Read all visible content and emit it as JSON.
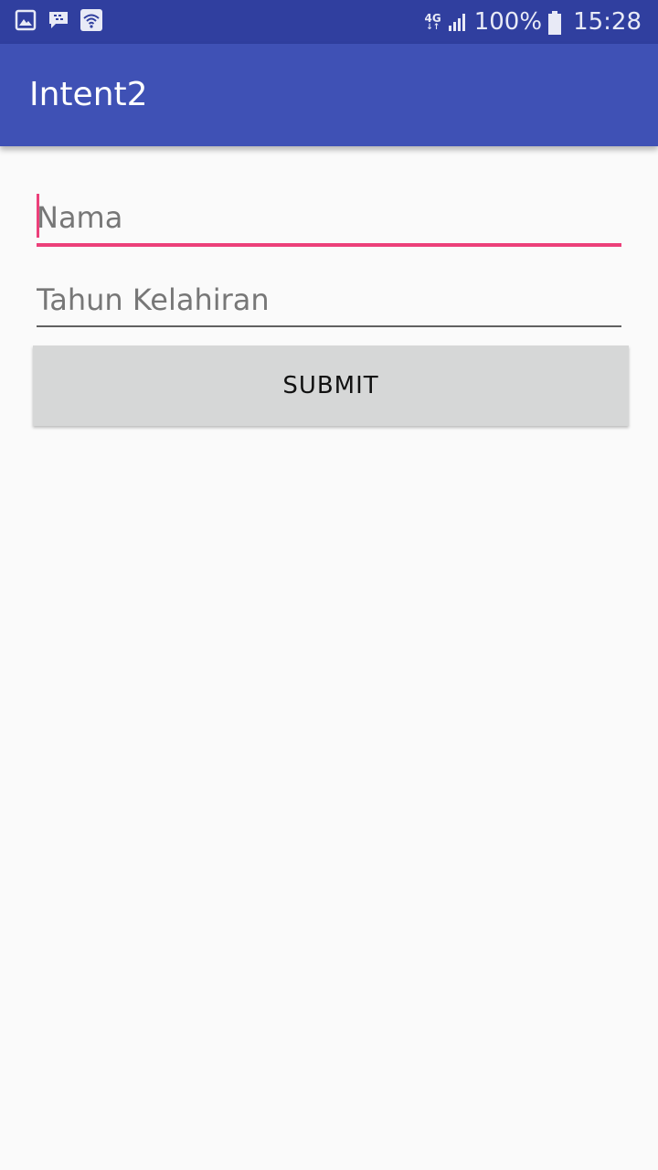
{
  "status_bar": {
    "icons_left": [
      "gallery-icon",
      "bbm-icon",
      "wifi-icon"
    ],
    "network_type": "4G",
    "network_arrows": "↓↑",
    "battery_percent": "100%",
    "time": "15:28"
  },
  "app_bar": {
    "title": "Intent2",
    "background_color": "#3f51b5",
    "status_bar_color": "#303f9f"
  },
  "form": {
    "nama": {
      "placeholder": "Nama",
      "value": "",
      "focused": true,
      "accent_color": "#ec407a"
    },
    "tahun_kelahiran": {
      "placeholder": "Tahun Kelahiran",
      "value": ""
    },
    "submit_label": "SUBMIT"
  }
}
